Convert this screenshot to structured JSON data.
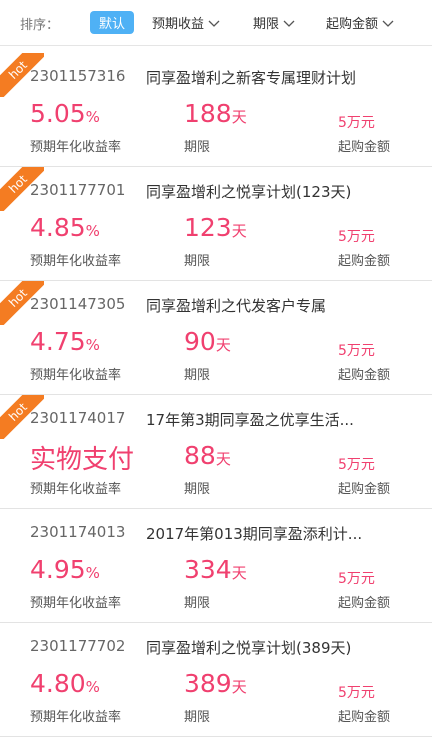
{
  "sortbar": {
    "label": "排序：",
    "default_label": "默认",
    "options": [
      {
        "label": "预期收益",
        "icon": "chevron-down-icon"
      },
      {
        "label": "期限",
        "icon": "chevron-down-icon"
      },
      {
        "label": "起购金额",
        "icon": "chevron-down-icon"
      }
    ]
  },
  "labels": {
    "rate": "预期年化收益率",
    "term": "期限",
    "min": "起购金额",
    "hot": "hot"
  },
  "colors": {
    "accent": "#f0406f",
    "hot_ribbon": "#f47c22",
    "active_sort": "#4fb1f5"
  },
  "products": [
    {
      "hot": true,
      "code": "2301157316",
      "title": "同享盈增利之新客专属理财计划",
      "rate": "5.05",
      "rate_unit": "%",
      "term": "188",
      "term_unit": "天",
      "min": "5万元"
    },
    {
      "hot": true,
      "code": "2301177701",
      "title": "同享盈增利之悦享计划(123天)",
      "rate": "4.85",
      "rate_unit": "%",
      "term": "123",
      "term_unit": "天",
      "min": "5万元"
    },
    {
      "hot": true,
      "code": "2301147305",
      "title": "同享盈增利之代发客户专属",
      "rate": "4.75",
      "rate_unit": "%",
      "term": "90",
      "term_unit": "天",
      "min": "5万元"
    },
    {
      "hot": true,
      "code": "2301174017",
      "title": "17年第3期同享盈之优享生活...",
      "rate": "实物支付",
      "rate_unit": "",
      "term": "88",
      "term_unit": "天",
      "min": "5万元"
    },
    {
      "hot": false,
      "code": "2301174013",
      "title": "2017年第013期同享盈添利计...",
      "rate": "4.95",
      "rate_unit": "%",
      "term": "334",
      "term_unit": "天",
      "min": "5万元"
    },
    {
      "hot": false,
      "code": "2301177702",
      "title": "同享盈增利之悦享计划(389天)",
      "rate": "4.80",
      "rate_unit": "%",
      "term": "389",
      "term_unit": "天",
      "min": "5万元"
    }
  ]
}
